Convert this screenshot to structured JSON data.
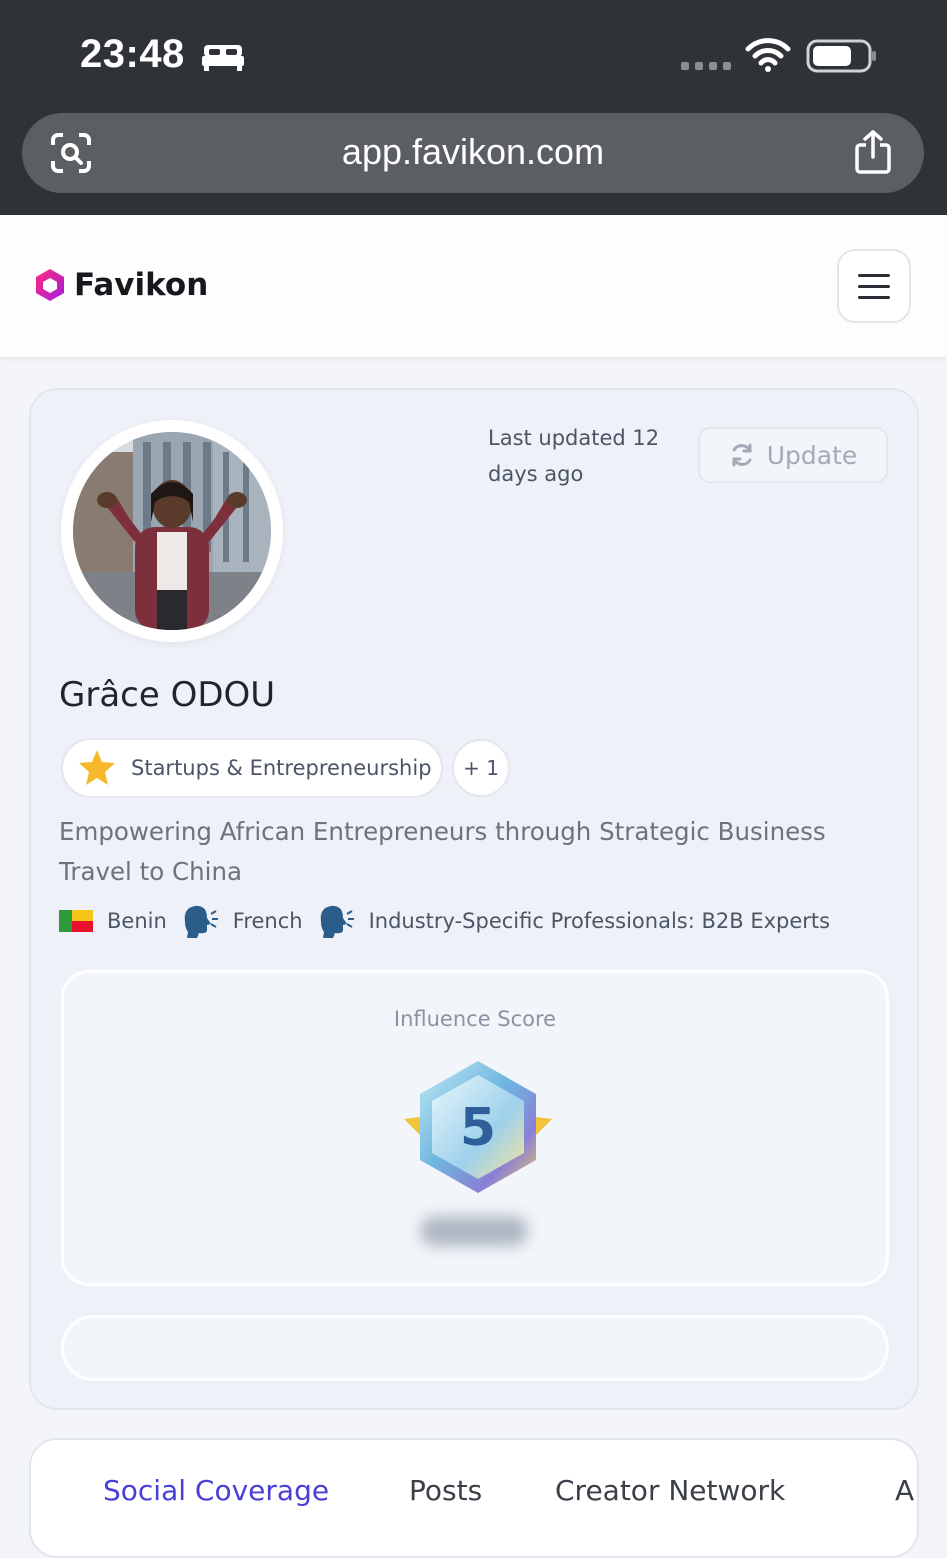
{
  "status_bar": {
    "time": "23:48"
  },
  "browser": {
    "url": "app.favikon.com"
  },
  "app": {
    "logo_text": "Favikon",
    "brand_color": "#d11fb5"
  },
  "profile": {
    "last_updated": "Last updated 12 days ago",
    "update_label": "Update",
    "name": "Grâce ODOU",
    "tag": "Startups & Entrepreneurship",
    "more_tags": "+ 1",
    "headline": "Empowering African Entrepreneurs through Strategic Business Travel to China",
    "country": "Benin",
    "language": "French",
    "category": "Industry-Specific Professionals: B2B Experts",
    "score_label": "Influence Score",
    "score_value": "5"
  },
  "tabs": [
    {
      "label": "Social Coverage",
      "active": true
    },
    {
      "label": "Posts",
      "active": false
    },
    {
      "label": "Creator Network",
      "active": false
    },
    {
      "label": "A",
      "active": false
    }
  ]
}
